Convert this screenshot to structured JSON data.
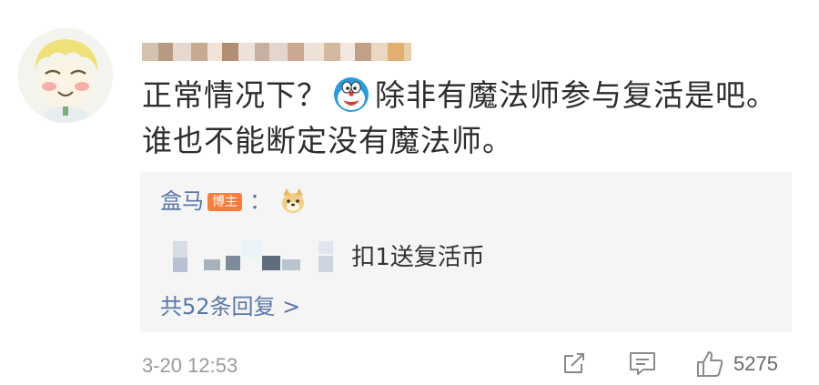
{
  "comment": {
    "text_before_emoji": "正常情况下？",
    "text_after_emoji": "除非有魔法师参与复活是吧。谁也不能断定没有魔法师。"
  },
  "reply": {
    "author": "盒马",
    "badge": "博主",
    "colon": "：",
    "text": "扣1送复活币",
    "more": "共52条回复 >"
  },
  "footer": {
    "time": "3-20 12:53",
    "like_count": "5275"
  },
  "icons": [
    "share-icon",
    "comment-icon",
    "like-icon"
  ],
  "colors": {
    "link": "#5878a8",
    "badge": "#ff7d3a",
    "reply_bg": "#f5f5f5"
  }
}
